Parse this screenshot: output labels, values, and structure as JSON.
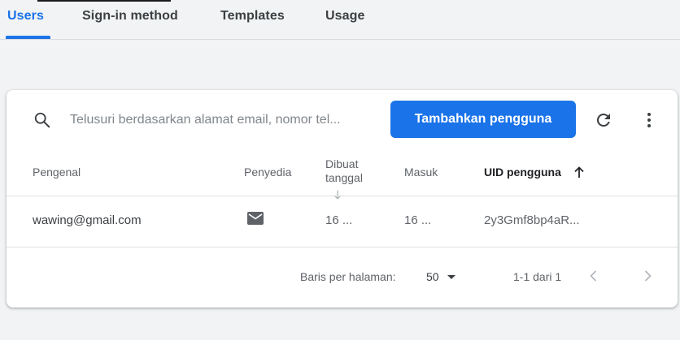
{
  "tabs": [
    {
      "label": "Users",
      "active": true
    },
    {
      "label": "Sign-in method",
      "active": false
    },
    {
      "label": "Templates",
      "active": false
    },
    {
      "label": "Usage",
      "active": false
    }
  ],
  "search": {
    "placeholder": "Telusuri berdasarkan alamat email, nomor tel...",
    "value": ""
  },
  "toolbar": {
    "add_user_label": "Tambahkan pengguna",
    "refresh_icon": "refresh-icon",
    "more_icon": "more-vert-icon"
  },
  "table": {
    "headers": {
      "identifier": "Pengenal",
      "provider": "Penyedia",
      "created": "Dibuat tanggal",
      "signed_in": "Masuk",
      "uid": "UID pengguna"
    },
    "rows": [
      {
        "identifier": "wawing@gmail.com",
        "provider_icon": "email-icon",
        "created": "16 ...",
        "signed_in": "16 ...",
        "uid": "2y3Gmf8bp4aR..."
      }
    ]
  },
  "pagination": {
    "rows_per_page_label": "Baris per halaman:",
    "rows_per_page": "50",
    "range": "1-1 dari 1"
  },
  "colors": {
    "accent": "#1a73e8",
    "text": "#3c4043",
    "muted": "#5f6368"
  }
}
